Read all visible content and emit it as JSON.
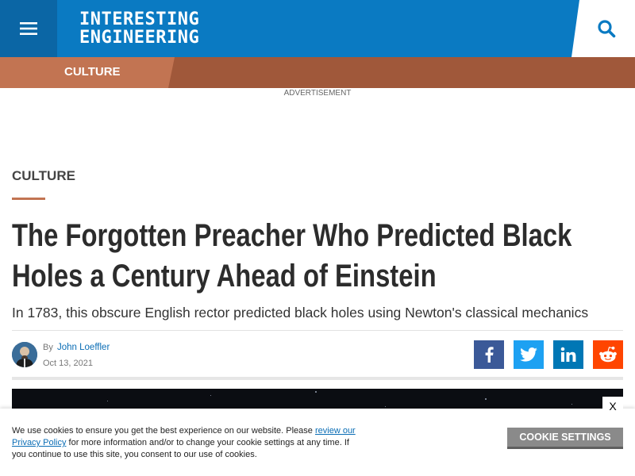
{
  "header": {
    "logo_line1": "INTERESTING",
    "logo_line2": "ENGINEERING",
    "menu_icon": "hamburger-icon",
    "search_icon": "search-icon"
  },
  "category_bar": {
    "label": "CULTURE"
  },
  "ad": {
    "label": "ADVERTISEMENT"
  },
  "article": {
    "category": "CULTURE",
    "title_line1": "The Forgotten Preacher Who Predicted Black",
    "title_line2": "Holes a Century Ahead of Einstein",
    "subtitle": "In 1783, this obscure English rector predicted black holes using Newton's classical mechanics",
    "by_label": "By",
    "author": "John Loeffler",
    "date": "Oct 13, 2021"
  },
  "share": {
    "facebook": "facebook-icon",
    "twitter": "twitter-icon",
    "linkedin": "linkedin-icon",
    "reddit": "reddit-icon"
  },
  "cookie": {
    "text_before": "We use cookies to ensure you get the best experience on our website. Please ",
    "link": "review our Privacy Policy",
    "text_after": " for more information and/or to change your cookie settings at any time. If you continue to use this site, you consent to our use of cookies.",
    "button": "COOKIE SETTINGS",
    "close": "X"
  },
  "colors": {
    "brand_blue": "#0a7ac2",
    "culture_accent": "#c27452"
  }
}
